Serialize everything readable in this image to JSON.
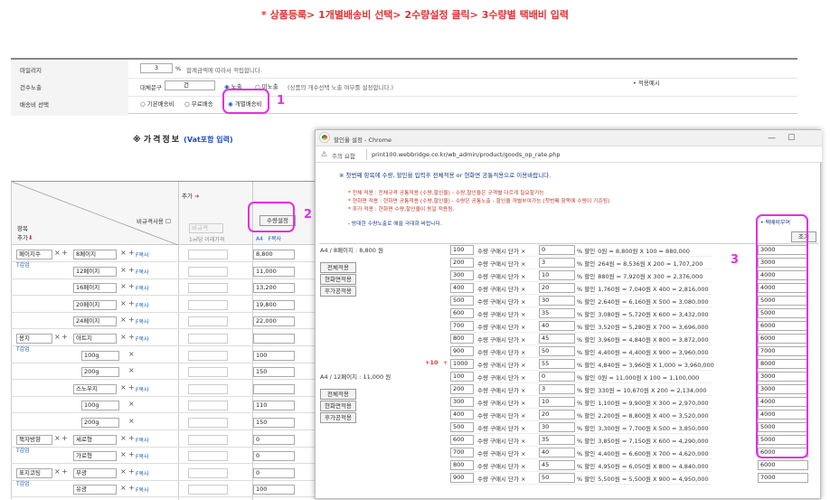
{
  "top_instruction": "* 상품등록> 1개별배송비 선택> 2수량설정 클릭> 3수량별 택배비 입력",
  "annotations": {
    "n1": "1",
    "n2": "2",
    "n3": "3"
  },
  "settings": {
    "mileage_label": "마일리지",
    "mileage_value": "3",
    "mileage_unit": "%",
    "mileage_note": "합계금액에 따라서 적립합니다.",
    "count_label": "건수노출",
    "count_prefix": "대체문구",
    "count_value": "건",
    "count_opt1": "노출",
    "count_opt2": "미노출",
    "count_note": "(상품의 개수선택 노출 여부를 설정합니다.)",
    "apply_example": "적용예시",
    "ship_label": "배송비 선택",
    "ship_opt1": "기본배송비",
    "ship_opt2": "무료배송",
    "ship_opt3": "개별배송비"
  },
  "price_info": {
    "title": "가격정보",
    "vat": "(Vat포함 입력)",
    "add_label": "추가",
    "nonstd_label": "비규격사용",
    "nonstd_placeholder": "비규격",
    "nonstd_note": "1㎡당 이래가격",
    "qty_set_btn": "수량설정",
    "item_header": "항목",
    "item_add": "추가",
    "fcopy": "F복사",
    "plus": "+",
    "x": "×"
  },
  "left_rows": [
    {
      "group": "페이지수",
      "g_link": "T갑업",
      "name": "8페이지",
      "price": "8,800"
    },
    {
      "group": "",
      "name": "12페이지",
      "price": "11,000"
    },
    {
      "group": "",
      "name": "16페이지",
      "price": "13,200"
    },
    {
      "group": "",
      "name": "20페이지",
      "price": "19,800"
    },
    {
      "group": "",
      "name": "24페이지",
      "price": "22,000"
    },
    {
      "group": "용지",
      "g_link": "T갑업",
      "name": "아트지",
      "price": ""
    },
    {
      "group": "",
      "name": "100g",
      "price": "100"
    },
    {
      "group": "",
      "name": "200g",
      "price": "150"
    },
    {
      "group": "",
      "name": "스노우지",
      "price": ""
    },
    {
      "group": "",
      "name": "100g",
      "price": "110"
    },
    {
      "group": "",
      "name": "200g",
      "price": "150"
    },
    {
      "group": "책자방향",
      "g_link": "T갑업",
      "name": "세로형",
      "price": "0"
    },
    {
      "group": "",
      "name": "가로형",
      "price": "0"
    },
    {
      "group": "표지코팅",
      "g_link": "T갑업",
      "name": "무광",
      "price": "0"
    },
    {
      "group": "",
      "name": "유광",
      "price": "100"
    }
  ],
  "popup": {
    "window_title": "할인율 설정 - Chrome",
    "security": "주의 요함",
    "url": "print100.webbridge.co.kr/wb_admin/product/goods_op_rate.php",
    "notice": "※ 첫번째 항목에 수량, 할인을 입력후 전체적용 or 현화면 공통적용으로 이용바랍니다.",
    "legend1": "* 전체 적용 : 전체규격 공통적용 (수량,할인율) - 수량,할인율은 규격별 다르게 필요할가능",
    "legend2": "* 현화면 적용 : 현화면 공통적용 (수량,할인율) - 수량은 공통노출 - 할인율 개별부여가능 (첫번째 항목에 수량이 기준됨)",
    "legend3": "* 후가 적용 : 현화면 수량,할인율이 동일 적용됨.",
    "legend4": "- 방대한 수량노출로 애쓸 극대화 바랍니다.",
    "ship_header": "택배비부여",
    "btn_all": "전체적용",
    "btn_screen": "현화면적용",
    "btn_after": "후가공적용",
    "plus10": "+10",
    "plus": "+",
    "qty_text": "수량 구매시 단가 ×",
    "pct_text": "% 할인",
    "sections": [
      {
        "title": "A4 / 8페이지 : 8,800 원",
        "rows": [
          {
            "qty": "100",
            "disc": "0",
            "calc": "0원 = 8,800원 X 100 = 880,000",
            "ship": "3000"
          },
          {
            "qty": "200",
            "disc": "3",
            "calc": "264원 = 8,536원 X 200 = 1,707,200",
            "ship": "3000"
          },
          {
            "qty": "300",
            "disc": "10",
            "calc": "880원 = 7,920원 X 300 = 2,376,000",
            "ship": "4000"
          },
          {
            "qty": "400",
            "disc": "20",
            "calc": "1,760원 = 7,040원 X 400 = 2,816,000",
            "ship": "4000"
          },
          {
            "qty": "500",
            "disc": "30",
            "calc": "2,640원 = 6,160원 X 500 = 3,080,000",
            "ship": "5000"
          },
          {
            "qty": "600",
            "disc": "35",
            "calc": "3,080원 = 5,720원 X 600 = 3,432,000",
            "ship": "5000"
          },
          {
            "qty": "700",
            "disc": "40",
            "calc": "3,520원 = 5,280원 X 700 = 3,696,000",
            "ship": "6000"
          },
          {
            "qty": "800",
            "disc": "45",
            "calc": "3,960원 = 4,840원 X 800 = 3,872,000",
            "ship": "6000"
          },
          {
            "qty": "900",
            "disc": "50",
            "calc": "4,400원 = 4,400원 X 900 = 3,960,000",
            "ship": "7000"
          },
          {
            "qty": "1000",
            "disc": "55",
            "calc": "4,840원 = 3,960원 X 1,000 = 3,960,000",
            "ship": "8000"
          }
        ]
      },
      {
        "title": "A4 / 12페이지 : 11,000 원",
        "rows": [
          {
            "qty": "100",
            "disc": "0",
            "calc": "0원 = 11,000원 X 100 = 1,100,000",
            "ship": "3000"
          },
          {
            "qty": "200",
            "disc": "3",
            "calc": "330원 = 10,670원 X 200 = 2,134,000",
            "ship": "3000"
          },
          {
            "qty": "300",
            "disc": "10",
            "calc": "1,100원 = 9,900원 X 300 = 2,970,000",
            "ship": "4000"
          },
          {
            "qty": "400",
            "disc": "20",
            "calc": "2,200원 = 8,800원 X 400 = 3,520,000",
            "ship": "4000"
          },
          {
            "qty": "500",
            "disc": "30",
            "calc": "3,300원 = 7,700원 X 500 = 3,850,000",
            "ship": "5000"
          },
          {
            "qty": "600",
            "disc": "35",
            "calc": "3,850원 = 7,150원 X 600 = 4,290,000",
            "ship": "5000"
          },
          {
            "qty": "700",
            "disc": "40",
            "calc": "4,400원 = 6,600원 X 700 = 4,620,000",
            "ship": "6000"
          },
          {
            "qty": "800",
            "disc": "45",
            "calc": "4,950원 = 6,050원 X 800 = 4,840,000",
            "ship": "6000"
          },
          {
            "qty": "900",
            "disc": "50",
            "calc": "5,500원 = 5,500원 X 900 = 4,950,000",
            "ship": "7000"
          }
        ]
      }
    ],
    "side_btn": "조기"
  }
}
